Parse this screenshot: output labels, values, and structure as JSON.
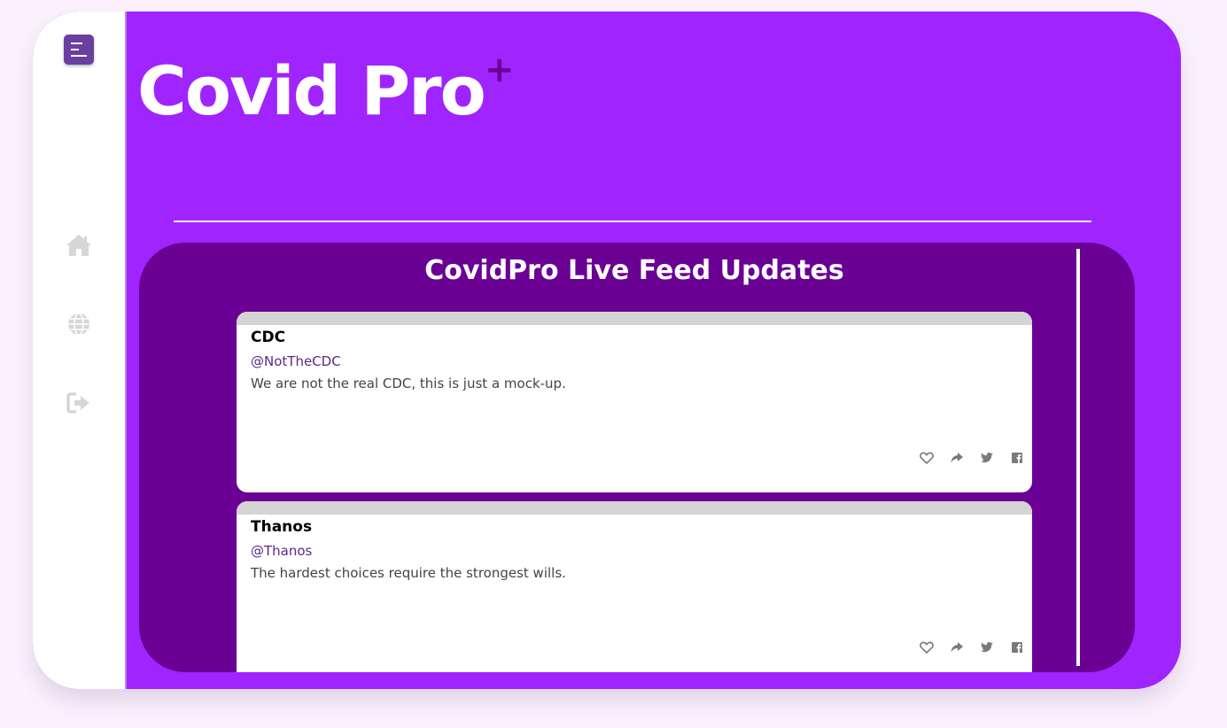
{
  "app": {
    "brand": "Covid Pro",
    "brand_mark": "+"
  },
  "sidebar": {
    "menu_icon": "menu-lines-icon",
    "items": [
      {
        "icon": "home-icon"
      },
      {
        "icon": "globe-icon"
      },
      {
        "icon": "sign-out-icon"
      }
    ]
  },
  "feed": {
    "title": "CovidPro Live Feed Updates",
    "posts": [
      {
        "name": "CDC",
        "handle": "@NotTheCDC",
        "text": "We are not the real CDC, this is just a mock-up."
      },
      {
        "name": "Thanos",
        "handle": "@Thanos",
        "text": "The hardest choices require the strongest wills."
      }
    ],
    "action_icons": [
      "heart-icon",
      "share-icon",
      "twitter-icon",
      "facebook-icon"
    ]
  },
  "colors": {
    "page_background": "#faf1fd",
    "primary": "#a024fe",
    "panel": "#6a0094",
    "menu_button": "#6a3fa0",
    "nav_icon": "#d6d6d6",
    "action_icon": "#7a7a7a"
  }
}
